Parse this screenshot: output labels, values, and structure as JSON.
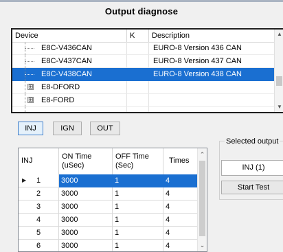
{
  "title": "Output diagnose",
  "device_grid": {
    "headers": {
      "device": "Device",
      "k": "K",
      "description": "Description"
    },
    "rows": [
      {
        "device": "E8C-V436CAN",
        "k": "",
        "description": "EURO-8 Version 436 CAN",
        "type": "leaf"
      },
      {
        "device": "E8C-V437CAN",
        "k": "",
        "description": "EURO-8 Version 437 CAN",
        "type": "leaf"
      },
      {
        "device": "E8C-V438CAN",
        "k": "",
        "description": "EURO-8 Version 438 CAN",
        "type": "leaf",
        "selected": true
      },
      {
        "device": "E8-DFORD",
        "k": "",
        "description": "",
        "type": "node"
      },
      {
        "device": "E8-FORD",
        "k": "",
        "description": "",
        "type": "node"
      }
    ],
    "expander_symbol": "⊞"
  },
  "mode_buttons": {
    "inj": "INJ",
    "ign": "IGN",
    "out": "OUT",
    "active": "INJ"
  },
  "inj_grid": {
    "headers": {
      "inj": "INJ",
      "on_time": "ON Time (uSec)",
      "off_time": "OFF Time (Sec)",
      "times": "Times"
    },
    "rows": [
      {
        "inj": "1",
        "on": "3000",
        "off": "1",
        "times": "4",
        "selected": true
      },
      {
        "inj": "2",
        "on": "3000",
        "off": "1",
        "times": "4"
      },
      {
        "inj": "3",
        "on": "3000",
        "off": "1",
        "times": "4"
      },
      {
        "inj": "4",
        "on": "3000",
        "off": "1",
        "times": "4"
      },
      {
        "inj": "5",
        "on": "3000",
        "off": "1",
        "times": "4"
      },
      {
        "inj": "6",
        "on": "3000",
        "off": "1",
        "times": "4"
      }
    ]
  },
  "selected_output": {
    "group_label": "Selected output",
    "value": "INJ (1)",
    "start_label": "Start Test"
  },
  "icons": {
    "row_pointer": "row-pointer-icon",
    "scroll_up": "chevron-up-icon",
    "scroll_down": "chevron-down-icon"
  },
  "colors": {
    "selection": "#1a6fd1",
    "window_bg": "#f0f0f0"
  }
}
